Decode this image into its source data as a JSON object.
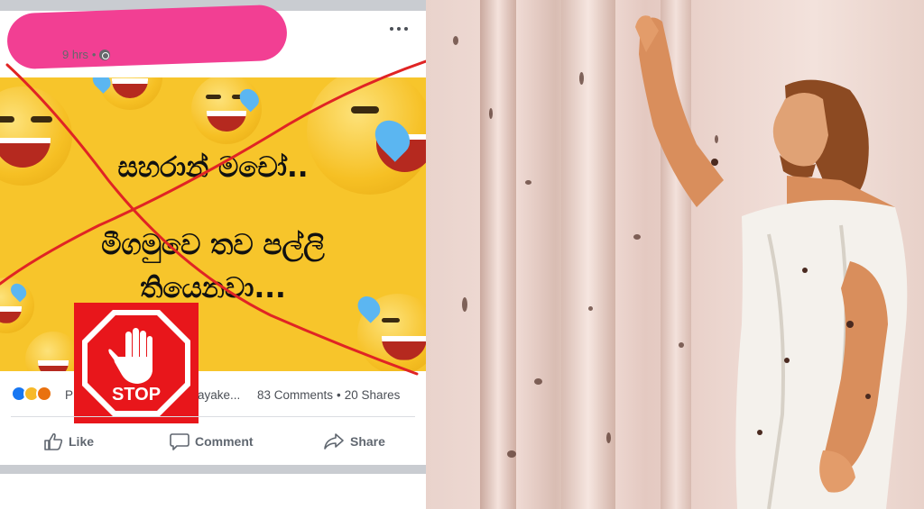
{
  "post": {
    "timestamp": "9 hrs",
    "privacy_separator": "•",
    "privacy_icon": "globe-icon",
    "more_icon": "more-options-icon",
    "image_text": {
      "line1": "සහරාන් මචෝ..",
      "line2": "මීගමුවෙ තව පල්ලි",
      "line3": "තියෙනවා..."
    },
    "stop_sign_text": "STOP",
    "reactions": {
      "icons": [
        "like-reaction-icon",
        "haha-reaction-icon",
        "angry-reaction-icon"
      ],
      "names_start": "P",
      "names_end": "ayake...",
      "comments": "83 Comments",
      "separator": "•",
      "shares": "20 Shares"
    },
    "actions": {
      "like_label": "Like",
      "comment_label": "Comment",
      "share_label": "Share"
    }
  },
  "colors": {
    "redaction": "#f23f93",
    "image_background": "#f7c52b",
    "cross_lines": "#e02424",
    "stop_background": "#e8161b",
    "facebook_grey": "#606770"
  }
}
